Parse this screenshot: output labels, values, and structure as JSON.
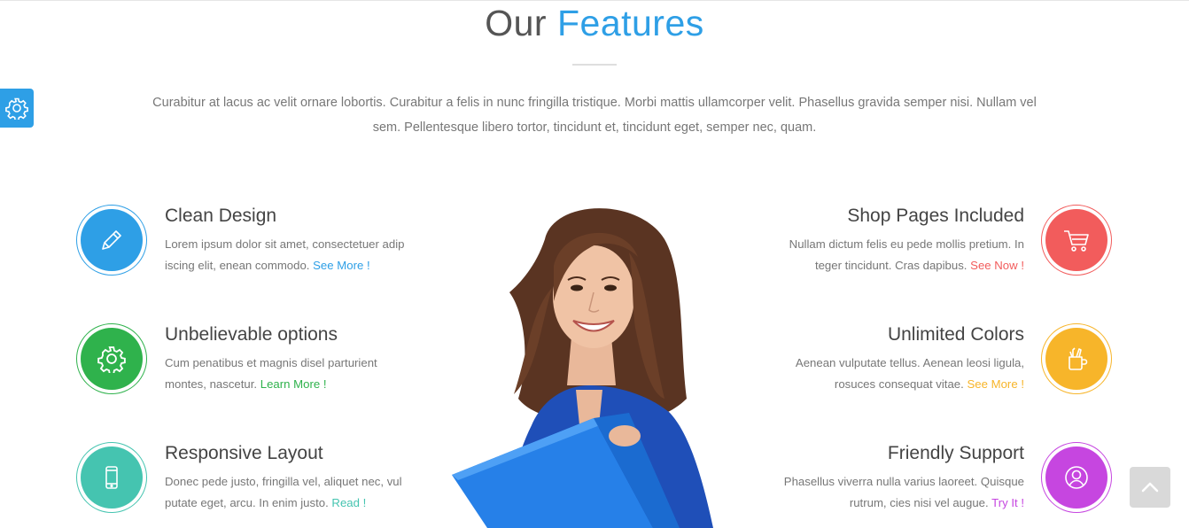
{
  "section": {
    "title_plain": "Our",
    "title_accent": "Features",
    "intro": "Curabitur at lacus ac velit ornare lobortis. Curabitur a felis in nunc fringilla tristique. Morbi mattis ullamcorper velit. Phasellus gravida semper nisi. Nullam vel sem. Pellentesque libero tortor, tincidunt et, tincidunt eget, semper nec, quam."
  },
  "features": {
    "clean_design": {
      "title": "Clean Design",
      "text": "Lorem ipsum dolor sit amet, consectetuer adip iscing elit, enean commodo.",
      "link": "See More !",
      "color": "#2e9fe6",
      "icon": "pencil-icon"
    },
    "unbelievable_options": {
      "title": "Unbelievable options",
      "text": "Cum penatibus et magnis disel parturient montes, nascetur.",
      "link": "Learn More !",
      "color": "#2fb24c",
      "icon": "gear-icon"
    },
    "responsive_layout": {
      "title": "Responsive Layout",
      "text": "Donec pede justo, fringilla vel, aliquet nec, vul putate eget, arcu. In enim justo.",
      "link": "Read !",
      "color": "#45c4b0",
      "icon": "mobile-icon"
    },
    "shop_pages": {
      "title": "Shop Pages Included",
      "text": "Nullam dictum felis eu pede mollis pretium. In teger tincidunt. Cras dapibus.",
      "link": "See Now !",
      "color": "#f25c5c",
      "icon": "cart-icon"
    },
    "unlimited_colors": {
      "title": "Unlimited Colors",
      "text": "Aenean vulputate tellus. Aenean leosi ligula, rosuces consequat vitae.",
      "link": "See More !",
      "color": "#f7b52a",
      "icon": "brush-cup-icon"
    },
    "friendly_support": {
      "title": "Friendly Support",
      "text": "Phasellus viverra nulla varius laoreet. Quisque rutrum, cies nisi vel augue.",
      "link": "Try It !",
      "color": "#c646e0",
      "icon": "user-circle-icon"
    }
  },
  "widgets": {
    "settings_icon": "gear-icon",
    "back_to_top_icon": "chevron-up-icon",
    "accent_color": "#2e9fe6"
  }
}
